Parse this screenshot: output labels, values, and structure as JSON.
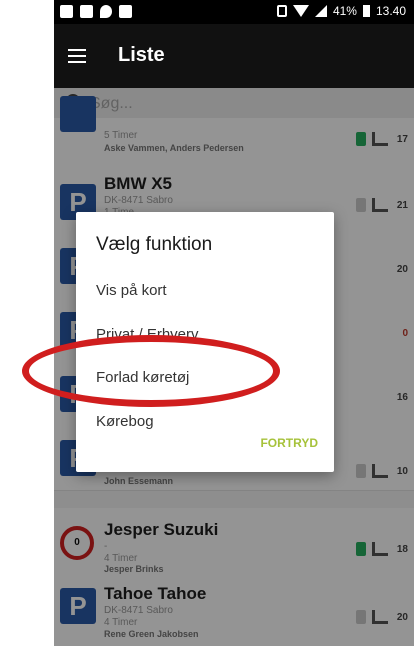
{
  "status_bar": {
    "battery": "41%",
    "time": "13.40"
  },
  "app_bar": {
    "title": "Liste"
  },
  "search": {
    "placeholder": "Søg..."
  },
  "list": [
    {
      "title": "",
      "sub1": "5 Timer",
      "sub2": "",
      "driver": "Aske Vammen, Anders Pedersen",
      "count": "17",
      "badge": "P",
      "status_color": "#27ae60"
    },
    {
      "title": "BMW X5",
      "sub1": "DK-8471 Sabro",
      "sub2": "1 Time",
      "driver": "",
      "count": "21",
      "badge": "P",
      "status_color": "#cccccc"
    },
    {
      "title": "",
      "sub1": "",
      "sub2": "",
      "driver": "",
      "count": "20",
      "badge": "P",
      "status_color": "#cccccc"
    },
    {
      "title": "",
      "sub1": "",
      "sub2": "",
      "driver": "",
      "count": "0",
      "badge": "P",
      "status_color": "#cccccc"
    },
    {
      "title": "",
      "sub1": "",
      "sub2": "",
      "driver": "",
      "count": "16",
      "badge": "P",
      "status_color": "#cccccc"
    },
    {
      "title": "",
      "sub1": "1 Time",
      "sub2": "",
      "driver": "John Essemann",
      "count": "10",
      "badge": "P",
      "status_color": "#cccccc"
    },
    {
      "title": "Jesper Suzuki",
      "sub1": "-",
      "sub2": "4 Timer",
      "driver": "Jesper Brinks",
      "count": "18",
      "badge": "0",
      "status_color": "#27ae60"
    },
    {
      "title": "Tahoe Tahoe",
      "sub1": "DK-8471 Sabro",
      "sub2": "4 Timer",
      "driver": "Rene Green Jakobsen",
      "count": "20",
      "badge": "P",
      "status_color": "#cccccc"
    }
  ],
  "dialog": {
    "title": "Vælg funktion",
    "items": [
      "Vis på kort",
      "Privat / Erhverv",
      "Forlad køretøj",
      "Kørebog"
    ],
    "cancel": "FORTRYD"
  },
  "colors": {
    "accent": "#a6c23a",
    "annotation": "#d01e1e",
    "parking_blue": "#2a5aa8"
  },
  "icons": {
    "menu": "hamburger-icon",
    "search": "search-icon",
    "seat": "car-seat-icon"
  }
}
